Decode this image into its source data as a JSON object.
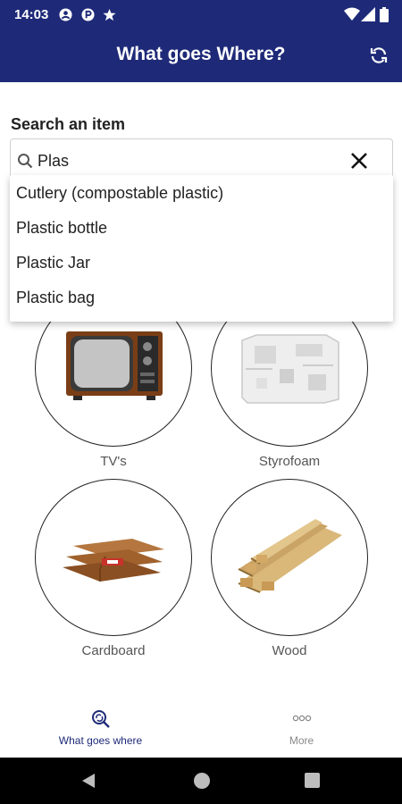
{
  "status_bar": {
    "time": "14:03"
  },
  "app_bar": {
    "title": "What goes Where?"
  },
  "search": {
    "label": "Search an item",
    "value": "Plas"
  },
  "suggestions": [
    "Cutlery (compostable plastic)",
    "Plastic bottle",
    "Plastic Jar",
    "Plastic bag"
  ],
  "items": [
    {
      "label": "TV's"
    },
    {
      "label": "Styrofoam"
    },
    {
      "label": "Cardboard"
    },
    {
      "label": "Wood"
    }
  ],
  "bottom_nav": [
    {
      "label": "What goes where",
      "active": true
    },
    {
      "label": "More",
      "active": false
    }
  ],
  "colors": {
    "primary": "#1e2a78",
    "active_tab": "#1e2a78",
    "inactive_tab": "#888888"
  }
}
